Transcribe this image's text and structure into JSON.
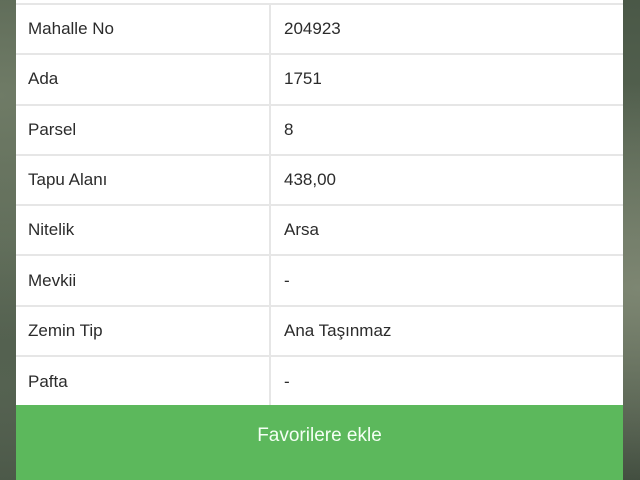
{
  "details": {
    "rows": [
      {
        "label": "Mahalle No",
        "value": "204923"
      },
      {
        "label": "Ada",
        "value": "1751"
      },
      {
        "label": "Parsel",
        "value": "8"
      },
      {
        "label": "Tapu Alanı",
        "value": "438,00"
      },
      {
        "label": "Nitelik",
        "value": "Arsa"
      },
      {
        "label": "Mevkii",
        "value": "-"
      },
      {
        "label": "Zemin Tip",
        "value": "Ana Taşınmaz"
      },
      {
        "label": "Pafta",
        "value": "-"
      }
    ]
  },
  "actions": {
    "add_favorite_label": "Favorilere ekle"
  },
  "colors": {
    "button_green": "#5cb85c",
    "divider": "#e6e6e6",
    "text": "#2b2b2b"
  }
}
